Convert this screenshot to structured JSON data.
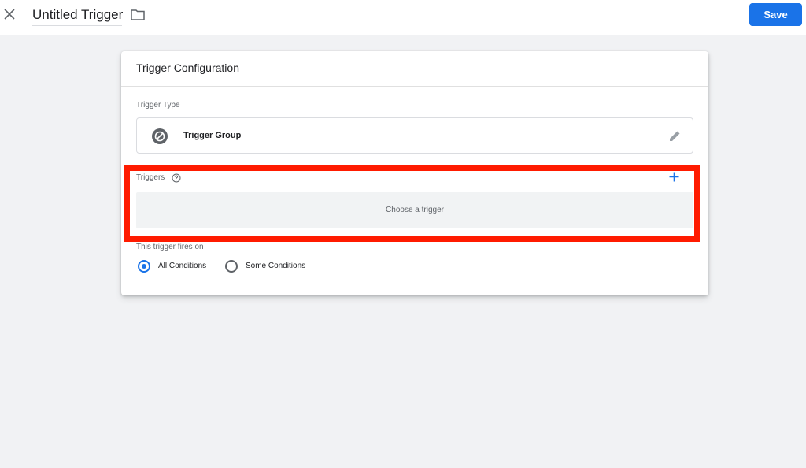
{
  "header": {
    "title": "Untitled Trigger",
    "save_label": "Save",
    "icons": {
      "close": "close-icon",
      "folder": "folder-icon"
    }
  },
  "card": {
    "title": "Trigger Configuration",
    "trigger_type": {
      "label": "Trigger Type",
      "name": "Trigger Group",
      "icon": "trigger-group-icon",
      "edit_icon": "pencil-icon"
    },
    "triggers": {
      "label": "Triggers",
      "placeholder": "Choose a trigger",
      "help_icon": "help-icon",
      "add_icon": "plus-icon"
    },
    "fires_on": {
      "label": "This trigger fires on",
      "options": [
        {
          "label": "All Conditions",
          "selected": true
        },
        {
          "label": "Some Conditions",
          "selected": false
        }
      ]
    }
  },
  "colors": {
    "accent": "#1a73e8",
    "highlight": "#ff1b00",
    "background": "#f1f2f4"
  }
}
